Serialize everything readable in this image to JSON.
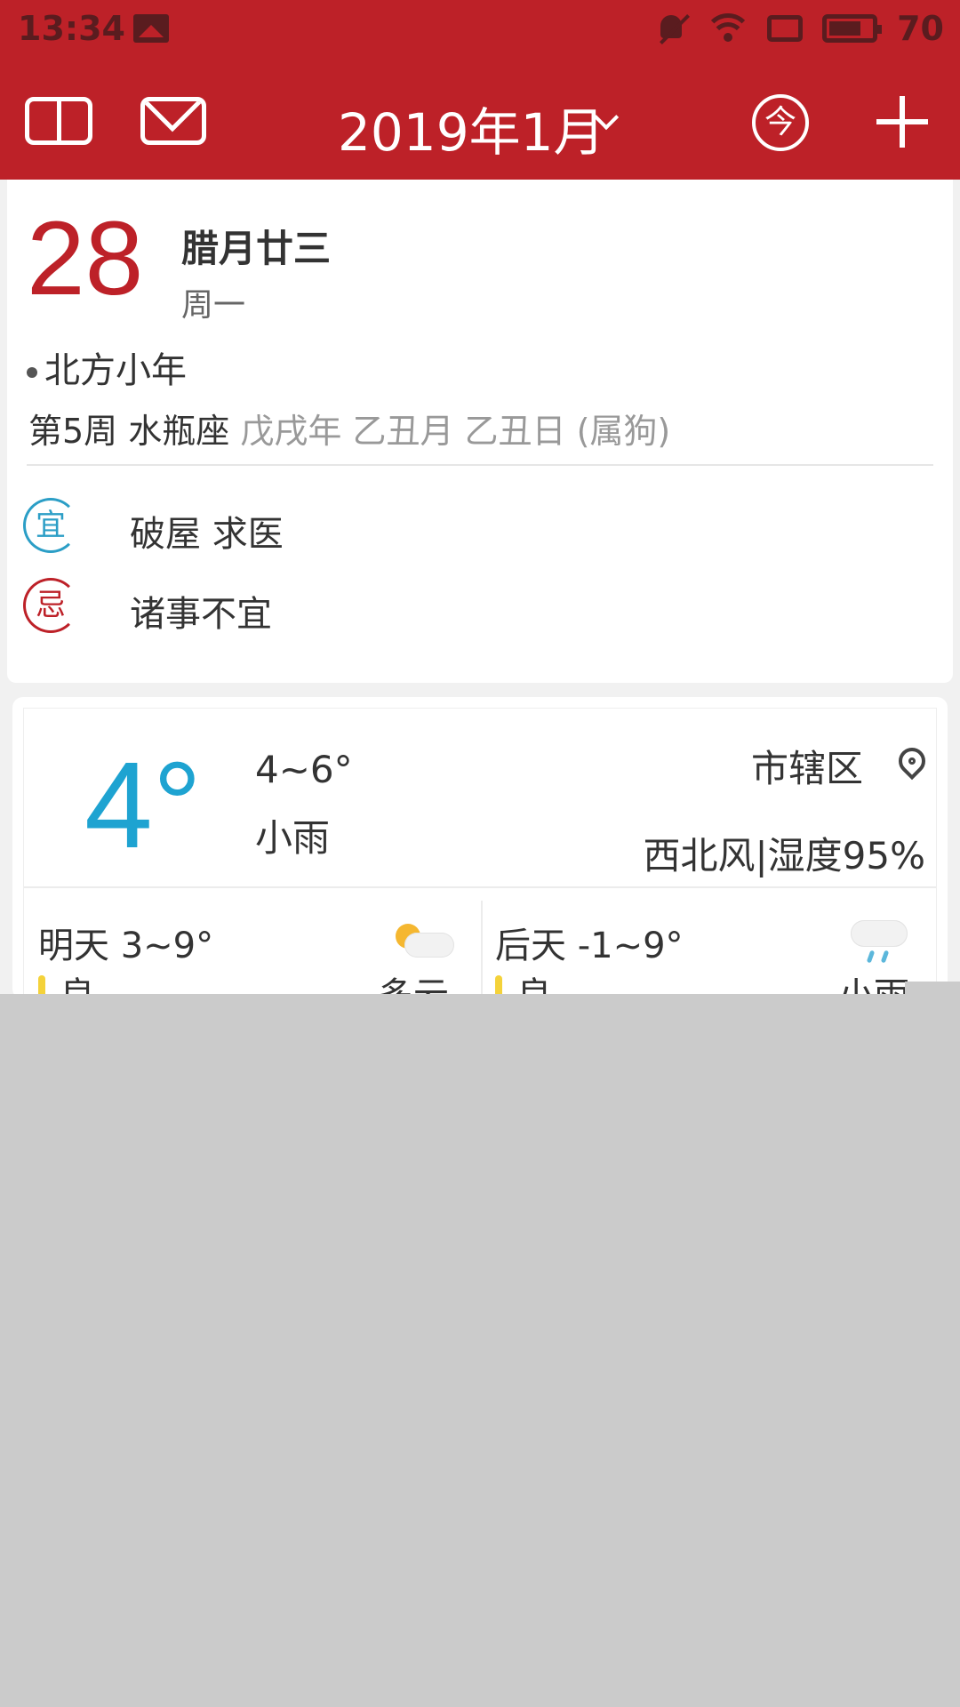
{
  "status_bar": {
    "time": "13:34",
    "battery": "70",
    "icons": [
      "image-icon",
      "bell-muted-icon",
      "wifi-icon",
      "screen-icon",
      "battery-icon"
    ]
  },
  "app_bar": {
    "month_title": "2019年1月",
    "today_label": "今",
    "icons": [
      "book-icon",
      "mail-icon",
      "chevron-down-icon",
      "today-icon",
      "plus-icon"
    ]
  },
  "date_card": {
    "day": "28",
    "lunar": "腊月廿三",
    "weekday": "周一",
    "festival": "北方小年",
    "week_info": "第5周 水瓶座",
    "ganzhi": "戊戌年 乙丑月 乙丑日 (属狗)",
    "yi_label": "宜",
    "yi_text": "破屋 求医",
    "ji_label": "忌",
    "ji_text": "诸事不宜"
  },
  "weather": {
    "temp_now": "4°",
    "range": "4~6°",
    "condition": "小雨",
    "location": "市辖区",
    "wind_humidity": "西北风|湿度95%",
    "tomorrow": {
      "label": "明天  3~9°",
      "air": "良",
      "condition": "多云"
    },
    "day_after": {
      "label": "后天  -1~9°",
      "air": "良",
      "condition": "小雨"
    }
  },
  "colors": {
    "brand_red": "#bd2128",
    "temp_blue": "#1ea3d1"
  }
}
